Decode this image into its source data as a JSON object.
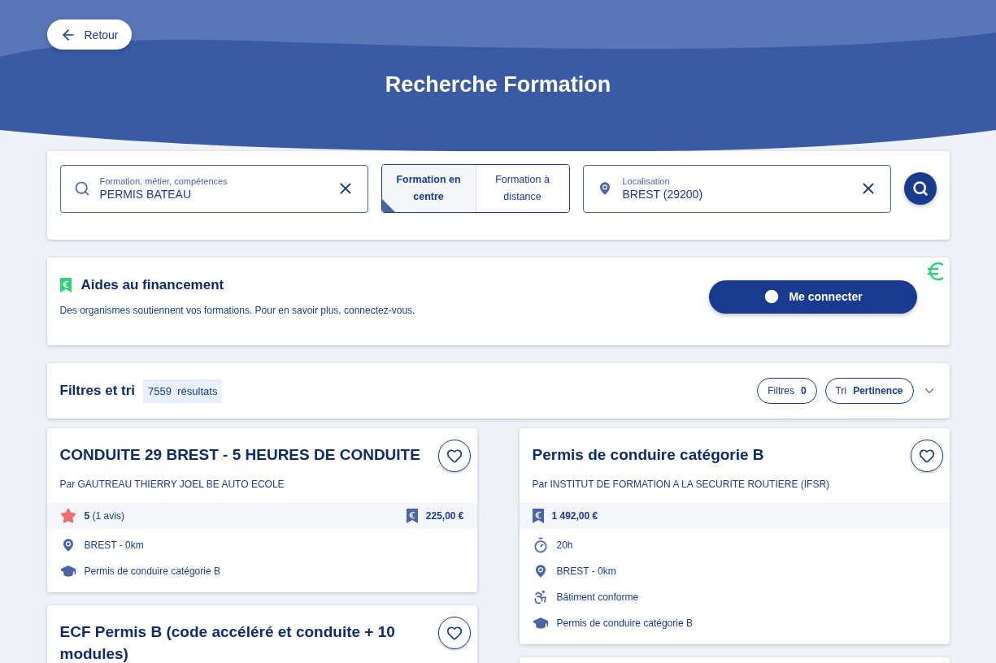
{
  "header": {
    "back_button": "Retour",
    "title": "Recherche Formation"
  },
  "search": {
    "what": {
      "label": "Formation, métier, compétences",
      "value": "PERMIS BATEAU"
    },
    "modes": [
      {
        "label": "Formation en centre",
        "selected": true
      },
      {
        "label": "Formation à distance",
        "selected": false
      }
    ],
    "where": {
      "label": "Localisation",
      "value": "BREST (29200)"
    }
  },
  "funding": {
    "title": "Aides au financement",
    "text": "Des organismes soutiennent vos formations. Pour en savoir plus, connectez-vous.",
    "button": "Me connecter"
  },
  "filters": {
    "title": "Filtres et tri",
    "count": "7559",
    "count_label": "résultats",
    "filter_button": {
      "label": "Filtres",
      "value": "0"
    },
    "sort_button": {
      "label": "Tri",
      "value": "Pertinence"
    }
  },
  "columns": [
    [
      {
        "title": "CONDUITE 29 BREST - 5 HEURES DE CONDUITE",
        "provider": "Par GAUTREAU THIERRY JOEL BE AUTO ECOLE",
        "rating": {
          "score": "5",
          "reviews": "(1 avis)"
        },
        "price": "225,00 €",
        "details": [
          {
            "kind": "location",
            "text": "BREST - 0km"
          },
          {
            "kind": "diploma",
            "text": "Permis de conduire catégorie B"
          }
        ]
      },
      {
        "title": "ECF Permis B (code accéléré et conduite + 10 modules)"
      }
    ],
    [
      {
        "title": "Permis de conduire catégorie B",
        "provider": "Par INSTITUT DE FORMATION A LA SECURITE ROUTIERE (IFSR)",
        "price": "1 492,00 €",
        "details": [
          {
            "kind": "duration",
            "text": "20h"
          },
          {
            "kind": "location",
            "text": "BREST - 0km"
          },
          {
            "kind": "access",
            "text": "Bâtiment conforme"
          },
          {
            "kind": "diploma",
            "text": "Permis de conduire catégorie B"
          }
        ]
      },
      {}
    ]
  ]
}
